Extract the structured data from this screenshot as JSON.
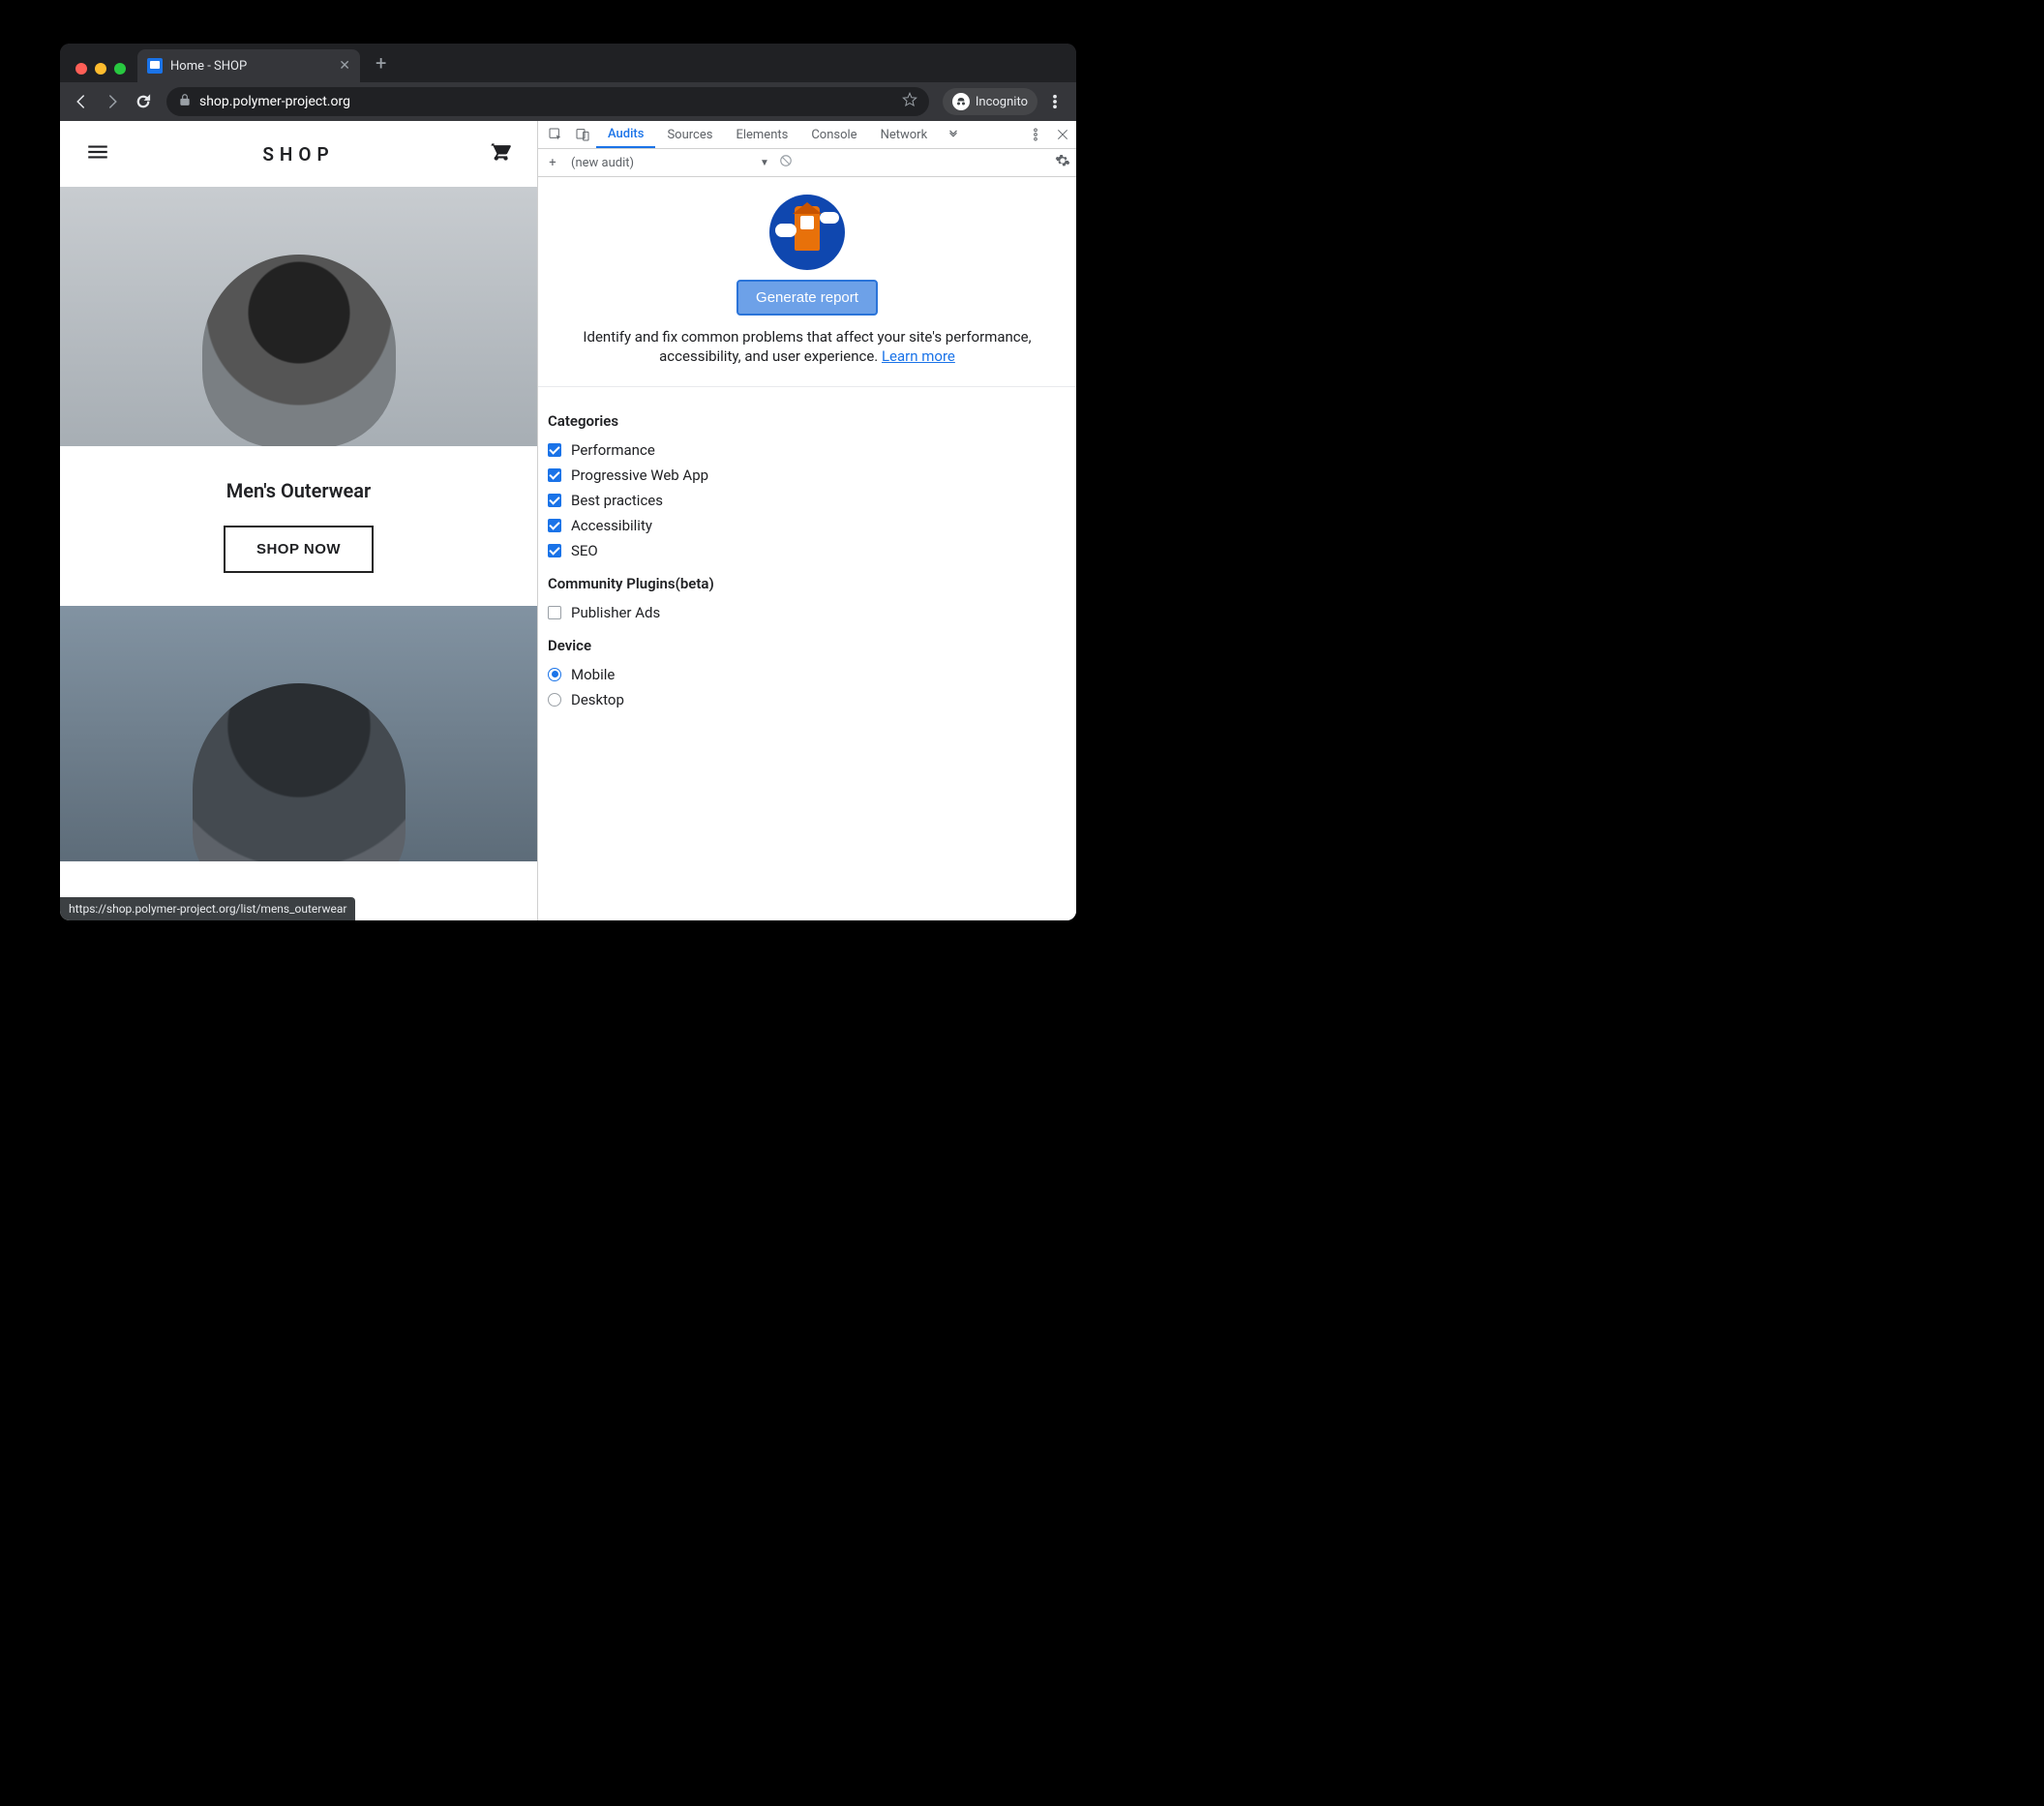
{
  "tab": {
    "title": "Home - SHOP"
  },
  "url": {
    "domain": "shop.polymer-project.org",
    "path": ""
  },
  "incognito_label": "Incognito",
  "page": {
    "logo": "SHOP",
    "section_title": "Men's Outerwear",
    "shop_now": "SHOP NOW"
  },
  "status_hover": "https://shop.polymer-project.org/list/mens_outerwear",
  "devtools": {
    "tabs": [
      "Audits",
      "Sources",
      "Elements",
      "Console",
      "Network"
    ],
    "active_tab": "Audits",
    "audit_select": "(new audit)",
    "generate_button": "Generate report",
    "description_1": "Identify and fix common problems that affect your site's performance, accessibility, and user experience. ",
    "learn_more": "Learn more",
    "categories_heading": "Categories",
    "categories": [
      {
        "label": "Performance",
        "checked": true
      },
      {
        "label": "Progressive Web App",
        "checked": true
      },
      {
        "label": "Best practices",
        "checked": true
      },
      {
        "label": "Accessibility",
        "checked": true
      },
      {
        "label": "SEO",
        "checked": true
      }
    ],
    "plugins_heading": "Community Plugins(beta)",
    "plugins": [
      {
        "label": "Publisher Ads",
        "checked": false
      }
    ],
    "device_heading": "Device",
    "devices": [
      {
        "label": "Mobile",
        "selected": true
      },
      {
        "label": "Desktop",
        "selected": false
      }
    ]
  }
}
